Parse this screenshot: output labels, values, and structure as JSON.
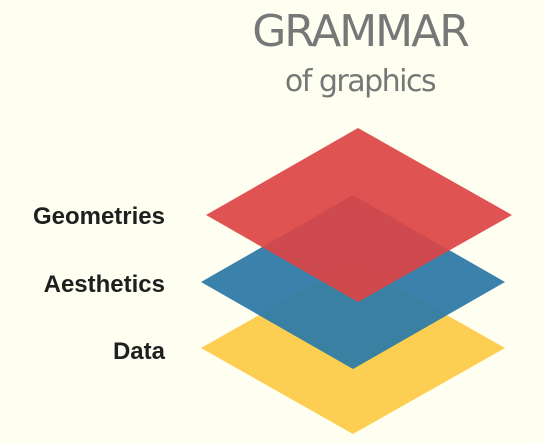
{
  "header": {
    "title": "GRAMMAR",
    "subtitle": "of graphics"
  },
  "layers": [
    {
      "label": "Geometries",
      "color": "#dc4545",
      "opacity": 0.92
    },
    {
      "label": "Aesthetics",
      "color": "#2f7ba6",
      "opacity": 0.95
    },
    {
      "label": "Data",
      "color": "#fcce52",
      "opacity": 1.0
    }
  ]
}
